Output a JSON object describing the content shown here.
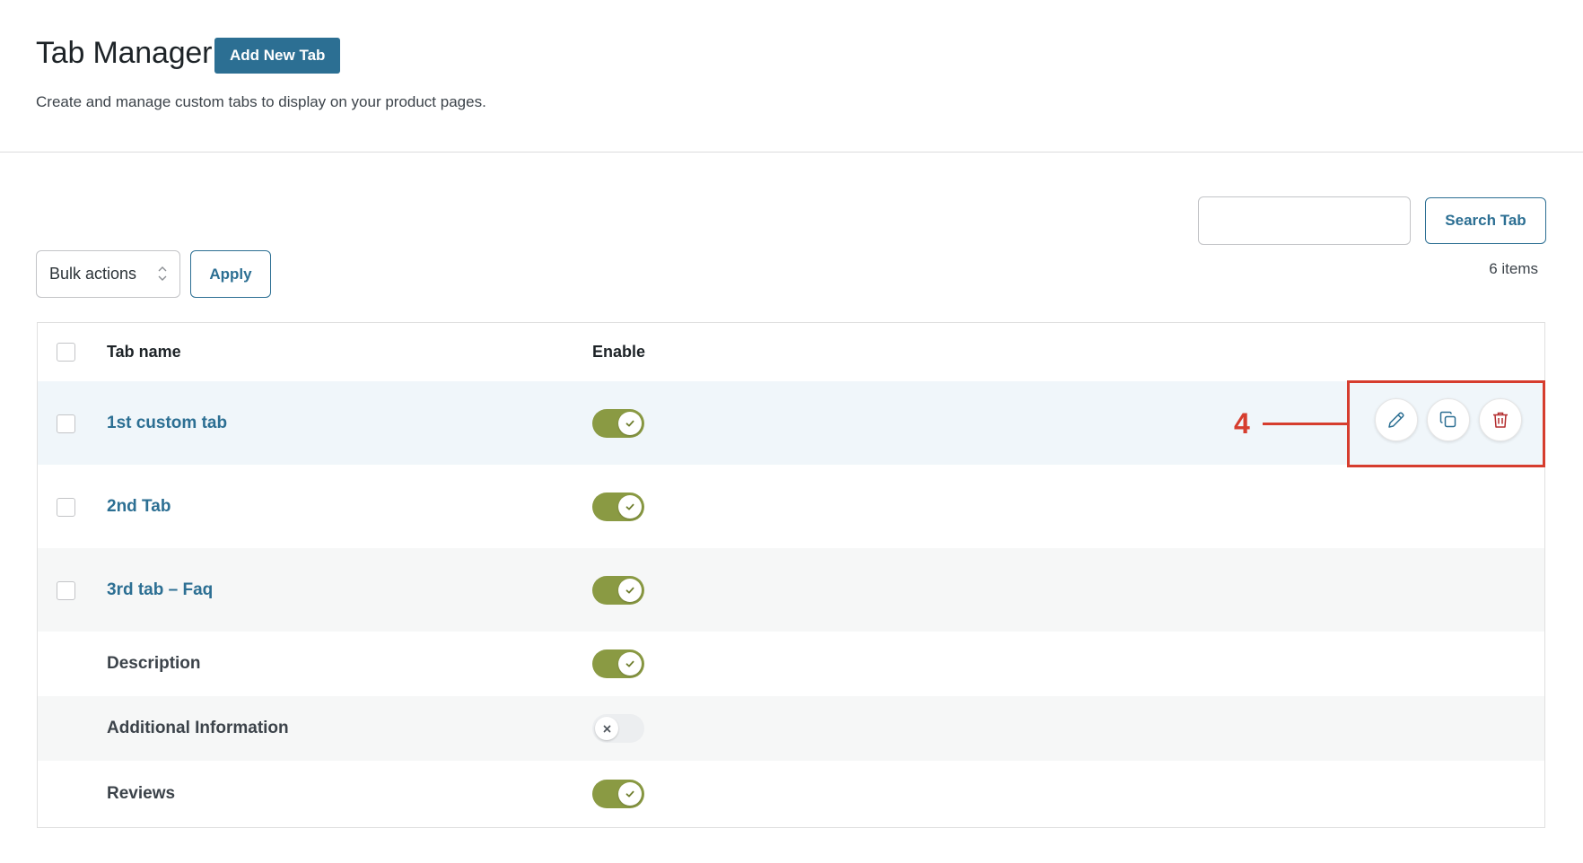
{
  "header": {
    "title": "Tab Manager",
    "add_button_label": "Add New Tab",
    "subtitle": "Create and manage custom tabs to display on your product pages."
  },
  "search": {
    "value": "",
    "button_label": "Search Tab"
  },
  "items_count": "6 items",
  "bulk": {
    "selected": "Bulk actions",
    "apply_label": "Apply"
  },
  "table": {
    "columns": [
      "Tab name",
      "Enable"
    ],
    "rows": [
      {
        "name": "1st custom tab",
        "enabled": true,
        "custom": true
      },
      {
        "name": "2nd Tab",
        "enabled": true,
        "custom": true
      },
      {
        "name": "3rd tab – Faq",
        "enabled": true,
        "custom": true
      },
      {
        "name": "Description",
        "enabled": true,
        "custom": false
      },
      {
        "name": "Additional Information",
        "enabled": false,
        "custom": false
      },
      {
        "name": "Reviews",
        "enabled": true,
        "custom": false
      }
    ]
  },
  "row_actions": {
    "icons": [
      "pencil-icon",
      "duplicate-icon",
      "trash-icon"
    ]
  },
  "annotation": {
    "label": "4",
    "color": "#d63d2e"
  },
  "colors": {
    "primary": "#2c6f93",
    "toggle_on": "#8a9a43",
    "toggle_off": "#eceef0",
    "trash": "#b32d2e"
  }
}
